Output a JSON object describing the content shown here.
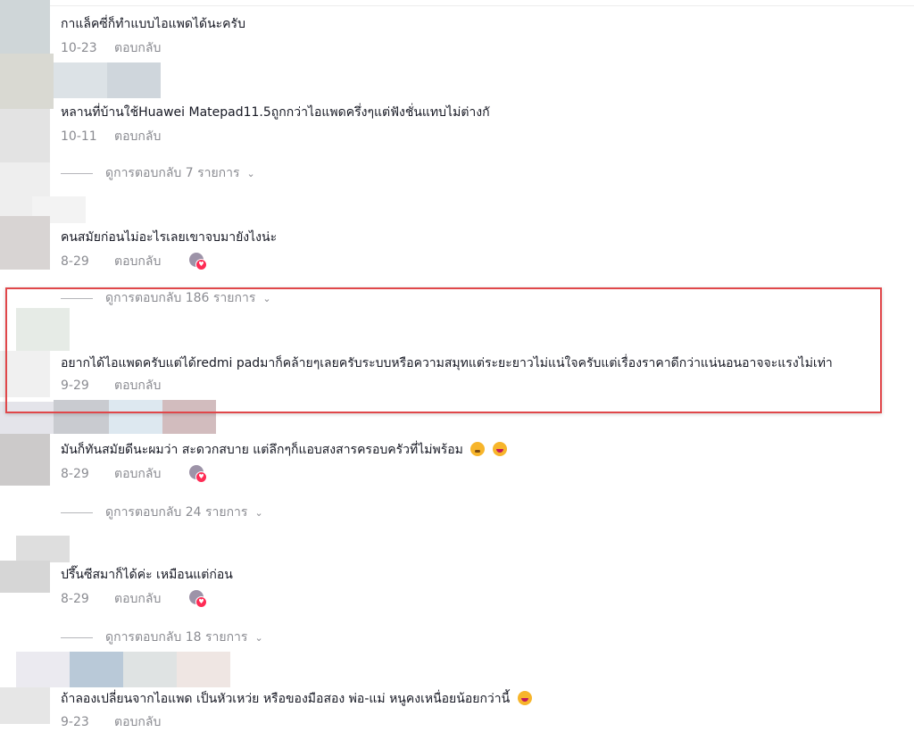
{
  "comments": [
    {
      "text": "กาแล็คซี่ก็ทำแบบไอแพดได้นะครับ",
      "date": "10-23",
      "reply": "ตอบกลับ"
    },
    {
      "text": "หลานที่บ้านใช้Huawei Matepad11.5ถูกกว่าไอแพดครึ่งๆแต่ฟังชั่นแทบไม่ต่างกั",
      "date": "10-11",
      "reply": "ตอบกลับ"
    },
    {
      "text": "คนสมัยก่อนไม่อะไรเลยเขาจบมายังไงน่ะ",
      "date": "8-29",
      "reply": "ตอบกลับ"
    },
    {
      "text": "อยากได้ไอแพดครับแต่ได้redmi padมาก็คล้ายๆเลยครับระบบหรือความสมุทแต่ระยะยาวไม่แน่ใจครับแต่เรื่องราคาดีกว่าแน่นอนอาจจะแรงไม่เท่า",
      "date": "9-29",
      "reply": "ตอบกลับ"
    },
    {
      "text": "มันก็ทันสมัยดีนะผมว่า สะดวกสบาย แต่ลึกๆก็แอบสงสารครอบครัวที่ไม่พร้อม",
      "date": "8-29",
      "reply": "ตอบกลับ"
    },
    {
      "text": "ปรึ๊นซีสมาก็ได้ค่ะ เหมือนแต่ก่อน",
      "date": "8-29",
      "reply": "ตอบกลับ"
    },
    {
      "text": "ถ้าลองเปลี่ยนจากไอแพด เป็นหัวเหว่ย หรือของมือสอง พ่อ-แม่ หนูคงเหนื่อยน้อยกว่านี้",
      "date": "9-23",
      "reply": "ตอบกลับ"
    }
  ],
  "view_replies": [
    {
      "label": "ดูการตอบกลับ 7 รายการ"
    },
    {
      "label": "ดูการตอบกลับ 186 รายการ"
    },
    {
      "label": "ดูการตอบกลับ 24 รายการ"
    },
    {
      "label": "ดูการตอบกลับ 18 รายการ"
    }
  ],
  "emoji_names": [
    "worried-face-emoji",
    "grinning-sweat-emoji"
  ],
  "colors": {
    "highlight": "#e0474a",
    "meta_text": "#8a8b91",
    "like_heart": "#fe2c55"
  }
}
